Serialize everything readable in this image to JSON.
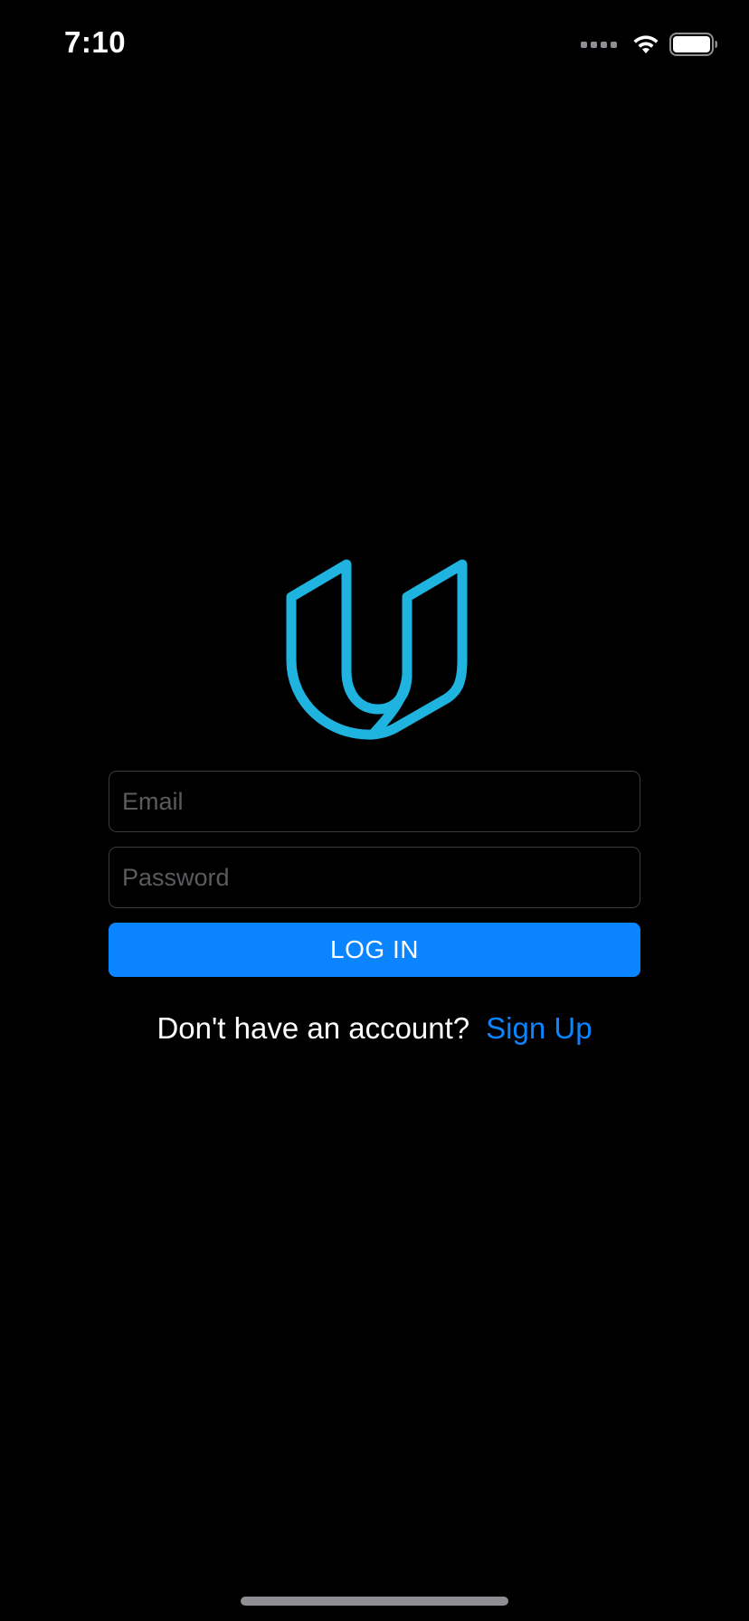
{
  "status_bar": {
    "time": "7:10",
    "icons": [
      "cellular-signal-icon",
      "wifi-icon",
      "battery-icon"
    ]
  },
  "logo": {
    "icon": "udacity-logo-icon",
    "color": "#1fb3e0"
  },
  "form": {
    "email_placeholder": "Email",
    "email_value": "",
    "password_placeholder": "Password",
    "password_value": "",
    "login_label": "LOG IN"
  },
  "signup": {
    "prompt": "Don't have an account?",
    "link_label": "Sign Up"
  },
  "colors": {
    "background": "#000000",
    "accent": "#0a84ff",
    "field_border": "#3a3a3c",
    "placeholder": "#5b5b5f"
  }
}
